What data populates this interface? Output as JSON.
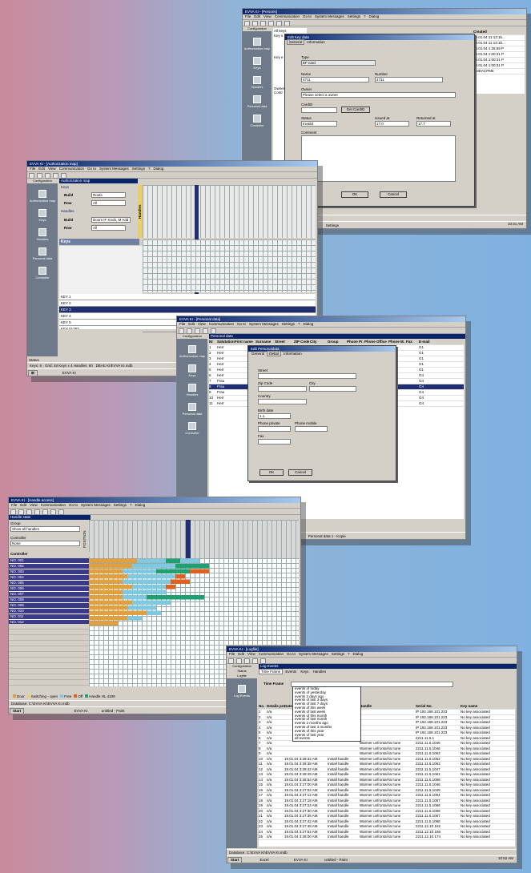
{
  "w1": {
    "title": "EVVA KI - [Persons]",
    "menu": [
      "File",
      "Edit",
      "View",
      "Communication",
      "Go to",
      "System Messages",
      "Settings",
      "?",
      "Dialog"
    ],
    "side_tab": "Configuration",
    "side_items": [
      "Authorization map",
      "Keys",
      "Handles",
      "Personal data",
      "Controller"
    ],
    "tree_header": "Name",
    "tree": [
      "All keys",
      "Key s",
      "",
      "",
      "",
      "",
      "Key e",
      "",
      "",
      "",
      "",
      "",
      "",
      "Owner",
      "Contr",
      "",
      "",
      "",
      "",
      "",
      "",
      "",
      ""
    ],
    "right_header": "Created",
    "right_rows": [
      "19.01.04 11:13:1b...",
      "19.01.04 11:13:1b...",
      "19.01.04 1:28:59 P",
      "19.01.04 1:00:31 P",
      "19.01.04 1:00:31 P",
      "19.01.04 1:00:31 P"
    ],
    "right_pos": "EMDACPM6",
    "dialog": {
      "title": "Edit Key data",
      "tabs": [
        "General",
        "Information"
      ],
      "type_label": "Type",
      "type_value": "EF card",
      "name_label": "Name",
      "name_value": "4711",
      "number_label": "Number",
      "number_value": "4711",
      "owner_label": "Owner",
      "owner_value": "Please select a owner",
      "card_label": "CardID",
      "card_btn": "Get CardID",
      "status_label": "Status",
      "status_value": "Invalid",
      "issued_label": "Issued at",
      "issued_value": "17.0",
      "returned_label": "Returned at",
      "returned_value": "17.7",
      "comment_label": "Comment",
      "ok": "OK",
      "cancel": "Cancel"
    },
    "status": [
      "KeyCount: 0",
      "EVVA KI - Persons",
      "Settings",
      "10:31 AM"
    ]
  },
  "w2": {
    "title": "EVVA KI - [Authorization map]",
    "menu": [
      "File",
      "Edit",
      "View",
      "Communication",
      "Go to",
      "System Messages",
      "Settings",
      "?",
      "Dialog"
    ],
    "side_tab": "Configuration",
    "side_items": [
      "Authorization map",
      "Keys",
      "Handles",
      "Personal data",
      "Controller"
    ],
    "panel_title": "Authorization map",
    "keys_section": "Keys",
    "fields": [
      {
        "label": "Build",
        "value": "Roots"
      },
      {
        "label": "Row",
        "value": "All"
      }
    ],
    "handles_section": "Handles",
    "fields2": [
      {
        "label": "Build",
        "value": "Doors IF Knob, M Add"
      },
      {
        "label": "Row",
        "value": "All"
      }
    ],
    "keys_header": "Keys",
    "handles_vertical": "Handles",
    "key_rows": [
      "KEY 1",
      "KEY 2",
      "KEY 3",
      "KEY 4",
      "KEY 5",
      "KEY 01283"
    ],
    "status_tab": "Status",
    "logfile_tab": "Logfile",
    "status": "Keys: 6 · Grid: 48 Keys x 4 Handles: 60",
    "status2": "DBAE KI/EVVA KI.mdb",
    "taskbar": "EVVA KI"
  },
  "w3": {
    "title": "EVVA KI - [Personal data]",
    "menu": [
      "File",
      "Edit",
      "View",
      "Communication",
      "Go to",
      "System Messages",
      "Settings",
      "?",
      "Dialog"
    ],
    "side_items": [
      "Authorization map",
      "Keys",
      "Handles",
      "Personal data",
      "Controller"
    ],
    "panel_title": "Personal data",
    "headers": [
      "Nr",
      "Salutation",
      "First name",
      "Surname",
      "Street",
      "ZIP Code",
      "City",
      "Group",
      "Phone Pr.",
      "Phone Office",
      "Phone M.",
      "Fax",
      "E-mail"
    ],
    "rows": [
      [
        "1",
        "Herr",
        "",
        "",
        "",
        "",
        "",
        "",
        "",
        "1 4936 53",
        "",
        "",
        "G1"
      ],
      [
        "2",
        "Herr",
        "",
        "",
        "",
        "",
        "",
        "",
        "",
        "1 4936 55",
        "",
        "",
        "G1"
      ],
      [
        "3",
        "Herr",
        "",
        "",
        "",
        "",
        "",
        "",
        "",
        "1 4936 56",
        "",
        "",
        "G1"
      ],
      [
        "4",
        "Herr",
        "",
        "",
        "",
        "",
        "",
        "",
        "",
        "1 4936 61",
        "",
        "",
        "G1"
      ],
      [
        "5",
        "Herr",
        "",
        "",
        "",
        "",
        "",
        "",
        "",
        "1 4936 62",
        "",
        "",
        "G1"
      ],
      [
        "6",
        "Herr",
        "",
        "Haspa",
        "",
        "",
        "",
        "",
        "",
        "1 4936 63",
        "",
        "",
        "G4"
      ],
      [
        "7",
        "Frau",
        "",
        "",
        "",
        "",
        "",
        "",
        "",
        "1 4936 64",
        "",
        "",
        "G4"
      ],
      [
        "8",
        "Frau",
        "",
        "",
        "",
        "",
        "",
        "",
        "",
        "1 4936 12",
        "",
        "",
        "G4"
      ],
      [
        "9",
        "Frau",
        "",
        "",
        "",
        "",
        "",
        "",
        "",
        "1 4936 15",
        "",
        "",
        "G4"
      ],
      [
        "10",
        "Herr",
        "",
        "",
        "",
        "",
        "",
        "",
        "",
        "1 4936 67",
        "",
        "",
        "G4"
      ],
      [
        "11",
        "Herr",
        "",
        "",
        "",
        "",
        "",
        "",
        "",
        "1 4936 54",
        "",
        "",
        "G4"
      ]
    ],
    "dialog": {
      "title": "Edit Personaldata",
      "tabs": [
        "General",
        "Detail",
        "Information"
      ],
      "street": "Street",
      "zip": "Zip Code",
      "city": "City",
      "country": "Country",
      "birthdate": "Birth date",
      "birth_value": "1.1.",
      "phone_private": "Phone private",
      "phone_mobile": "Phone mobile",
      "fax": "Fax",
      "ok": "OK",
      "cancel": "Cancel"
    },
    "status": [
      "Personal data 1 - Kopie"
    ]
  },
  "w4": {
    "title": "EVVA KI - [Handle access]",
    "menu": [
      "File",
      "Edit",
      "View",
      "Communication",
      "Go to",
      "System Messages",
      "Settings",
      "?",
      "Dialog"
    ],
    "panel_title": "Handle state",
    "group_label": "Group",
    "group_value": "Show all handles",
    "controller_label": "Controller",
    "controller_value": "None",
    "list_header": "Controller",
    "positions_vertical": "POSITION",
    "rows": [
      "NO. 001",
      "NO. 002",
      "NO. 003",
      "NO. 004",
      "NO. 005",
      "NO. 006",
      "NO. 007",
      "NO. 008",
      "NO. 009",
      "NO. 010",
      "NO. 011",
      "NO. 012",
      "NO. 013"
    ],
    "legend": [
      {
        "label": "Door",
        "color": "#e0a040"
      },
      {
        "label": "Switching - open",
        "color": "#f0d060"
      },
      {
        "label": "Free",
        "color": "#80c8e0"
      },
      {
        "label": "Off",
        "color": "#e06020"
      },
      {
        "label": "Handle HL 4109",
        "color": "#20a070"
      }
    ],
    "status": "Database: C:\\EVVA KI\\EVVA KI.mdb",
    "taskbar": [
      "Start",
      "EVVA KI",
      "untitled - Paint"
    ]
  },
  "w5": {
    "title": "EVVA KI - [Logfile]",
    "menu": [
      "File",
      "Edit",
      "View",
      "Communication",
      "Go to",
      "System Messages",
      "Settings",
      "?",
      "Dialog"
    ],
    "side_tabs": [
      "Configuration",
      "Status",
      "Logfile"
    ],
    "side_item": "Log Events",
    "panel_title": "Log Events",
    "tabs": [
      "Time Frame",
      "Events",
      "Keys",
      "Handles"
    ],
    "time_label": "Time Frame",
    "dropdown_items": [
      "events of today",
      "events of yesterday",
      "events 2 days ago",
      "events of last 3 days",
      "events of last 7 days",
      "events of this week",
      "events of last week",
      "events of this month",
      "events of last month",
      "events 2 months ago",
      "events of last 3 months",
      "events of this year",
      "events of last year",
      "all events"
    ],
    "headers": [
      "No.",
      "Details present",
      "Date",
      "Event",
      "Handle",
      "Serial No.",
      "Key name"
    ],
    "rows": [
      [
        "1",
        "n/a",
        "",
        "",
        "",
        "IP 192.168.101.223",
        "No key associated"
      ],
      [
        "2",
        "n/a",
        "",
        "",
        "",
        "IP 192.168.101.223",
        "No key associated"
      ],
      [
        "3",
        "n/a",
        "",
        "",
        "",
        "IP 192.168.101.223",
        "No key associated"
      ],
      [
        "4",
        "n/a",
        "",
        "",
        "",
        "IP 192.168.101.223",
        "No key associated"
      ],
      [
        "5",
        "n/a",
        "",
        "",
        "",
        "IP 192.168.101.223",
        "No key associated"
      ],
      [
        "6",
        "n/a",
        "",
        "",
        "",
        "2211.11.5.1",
        "No key associated"
      ],
      [
        "7",
        "n/a",
        "",
        "",
        "Warmer unfrontal-lar tune",
        "2211.11.5.1046",
        "No key associated"
      ],
      [
        "8",
        "n/a",
        "",
        "",
        "Warmer unfrontal-lar tune",
        "2211.11.5.1046",
        "No key associated"
      ],
      [
        "9",
        "n/a",
        "",
        "",
        "Warmer unfrontal-lar tune",
        "2211.11.5.1063",
        "No key associated"
      ],
      [
        "10",
        "n/a",
        "19.01.04 3:28:32 AM",
        "Install handle",
        "Warmer unfrontal-lar tune",
        "2211.11.5.1052",
        "No key associated"
      ],
      [
        "11",
        "n/a",
        "19.01.04 3:28:38 AM",
        "Install handle",
        "Warmer unfrontal-lar tune",
        "2211.11.5.1063",
        "No key associated"
      ],
      [
        "12",
        "n/a",
        "19.01.04 3:28:42 AM",
        "Install handle",
        "Warmer unfrontal-lar tune",
        "2211.11.5.1047",
        "No key associated"
      ],
      [
        "13",
        "n/a",
        "19.01.04 3:28:49 AM",
        "Install handle",
        "Warmer unfrontal-lar tune",
        "2211.11.5.1061",
        "No key associated"
      ],
      [
        "14",
        "n/a",
        "19.01.04 3:28:54 AM",
        "Install handle",
        "Warmer unfrontal-lar tune",
        "2211.11.5.1058",
        "No key associated"
      ],
      [
        "15",
        "n/a",
        "19.01.04 3:27:00 AM",
        "Install handle",
        "Warmer unfrontal-lar tune",
        "2211.11.5.1046",
        "No key associated"
      ],
      [
        "16",
        "n/a",
        "19.01.04 3:27:04 AM",
        "Install handle",
        "Warmer unfrontal-lar tune",
        "2211.11.5.1049",
        "No key associated"
      ],
      [
        "17",
        "n/a",
        "19.01.04 3:27:12 AM",
        "Install handle",
        "Warmer unfrontal-lar tune",
        "2211.11.5.1064",
        "No key associated"
      ],
      [
        "18",
        "n/a",
        "19.01.04 3:27:18 AM",
        "Install handle",
        "Warmer unfrontal-lar tune",
        "2211.11.5.1057",
        "No key associated"
      ],
      [
        "19",
        "n/a",
        "19.01.04 3:27:24 AM",
        "Install handle",
        "Warmer unfrontal-lar tune",
        "2211.11.5.1066",
        "No key associated"
      ],
      [
        "20",
        "n/a",
        "19.01.04 3:27:30 AM",
        "Install handle",
        "Warmer unfrontal-lar tune",
        "2211.11.5.1059",
        "No key associated"
      ],
      [
        "21",
        "n/a",
        "19.01.04 3:27:36 AM",
        "Install handle",
        "Warmer unfrontal-lar tune",
        "2211.11.5.1067",
        "No key associated"
      ],
      [
        "22",
        "n/a",
        "19.01.04 3:27:42 AM",
        "Install handle",
        "Warmer unfrontal-lar tune",
        "2211.11.5.1068",
        "No key associated"
      ],
      [
        "23",
        "n/a",
        "19.01.04 3:27:48 AM",
        "Install handle",
        "Warmer unfrontal-lar tune",
        "2211.12.10.162",
        "No key associated"
      ],
      [
        "24",
        "n/a",
        "19.01.04 3:27:54 AM",
        "Install handle",
        "Warmer unfrontal-lar tune",
        "2211.12.10.166",
        "No key associated"
      ],
      [
        "25",
        "n/a",
        "19.01.04 3:28:00 AM",
        "Install handle",
        "Warmer unfrontal-lar tune",
        "2211.12.10.174",
        "No key associated"
      ]
    ],
    "status": "Database: C:\\EVVA KI\\EVVA KI.mdb",
    "taskbar": [
      "Start",
      "Excel",
      "EVVA KI",
      "untitled - Paint"
    ],
    "clock": "10:52 AM"
  }
}
